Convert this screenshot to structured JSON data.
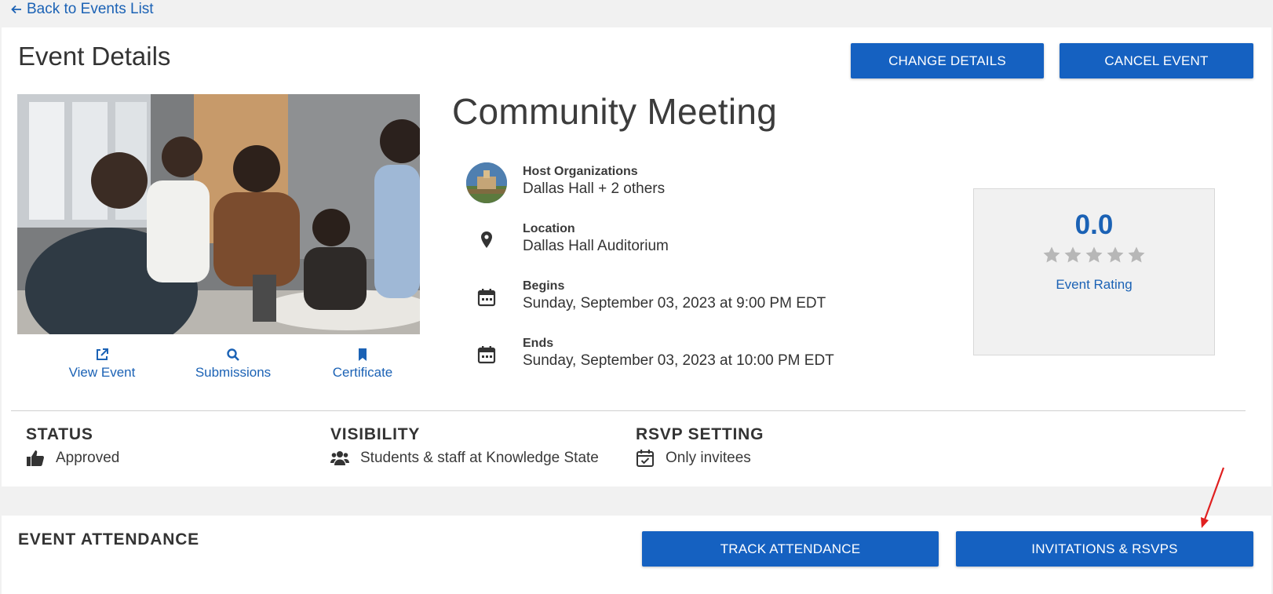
{
  "nav": {
    "back_label": "Back to Events List"
  },
  "header": {
    "title": "Event Details",
    "change_label": "CHANGE DETAILS",
    "cancel_label": "CANCEL EVENT"
  },
  "photo_actions": [
    {
      "label": "View Event",
      "icon": "external-link-icon"
    },
    {
      "label": "Submissions",
      "icon": "search-icon"
    },
    {
      "label": "Certificate",
      "icon": "bookmark-icon"
    }
  ],
  "event": {
    "name": "Community Meeting",
    "host": {
      "label": "Host Organizations",
      "value": "Dallas Hall + 2 others"
    },
    "location": {
      "label": "Location",
      "value": "Dallas Hall Auditorium"
    },
    "begins": {
      "label": "Begins",
      "value": "Sunday, September 03, 2023 at 9:00 PM EDT"
    },
    "ends": {
      "label": "Ends",
      "value": "Sunday, September 03, 2023 at 10:00 PM EDT"
    }
  },
  "rating": {
    "value": "0.0",
    "stars_filled": 0,
    "stars_total": 5,
    "label": "Event Rating"
  },
  "meta": {
    "status": {
      "title": "STATUS",
      "value": "Approved",
      "icon": "thumbs-up-icon"
    },
    "visibility": {
      "title": "VISIBILITY",
      "value": "Students & staff at Knowledge State",
      "icon": "users-icon"
    },
    "rsvp": {
      "title": "RSVP SETTING",
      "value": "Only invitees",
      "icon": "calendar-check-icon"
    }
  },
  "attendance": {
    "title": "EVENT ATTENDANCE",
    "track_label": "TRACK ATTENDANCE",
    "invite_label": "INVITATIONS & RSVPS"
  },
  "colors": {
    "accent": "#1561c1",
    "link": "#1b62b5",
    "annotation": "#e02020"
  }
}
